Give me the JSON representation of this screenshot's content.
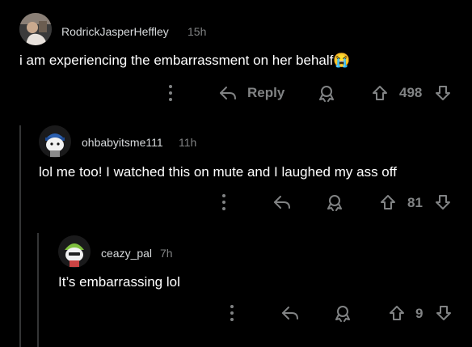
{
  "comments": [
    {
      "username": "RodrickJasperHeffley",
      "time": "15h",
      "text": "i am experiencing the embarrassment on her behalf",
      "emoji": "😭",
      "reply_label": "Reply",
      "votes": "498",
      "avatar": "profile-photo"
    },
    {
      "username": "ohbabyitsme111",
      "time": "11h",
      "text": "lol me too! I watched this on mute and I laughed my ass off",
      "votes": "81",
      "avatar": "snoo-avatar-blue-cap"
    },
    {
      "username": "ceazy_pal",
      "time": "7h",
      "text": "It’s embarrassing lol",
      "votes": "9",
      "avatar": "snoo-avatar-green"
    }
  ],
  "icons": {
    "more": "more-dots-icon",
    "reply": "reply-arrow-icon",
    "award": "award-icon",
    "upvote": "upvote-icon",
    "downvote": "downvote-icon"
  },
  "colors": {
    "background": "#000000",
    "text": "#ffffff",
    "muted": "#818384",
    "thread_line": "#343536"
  }
}
